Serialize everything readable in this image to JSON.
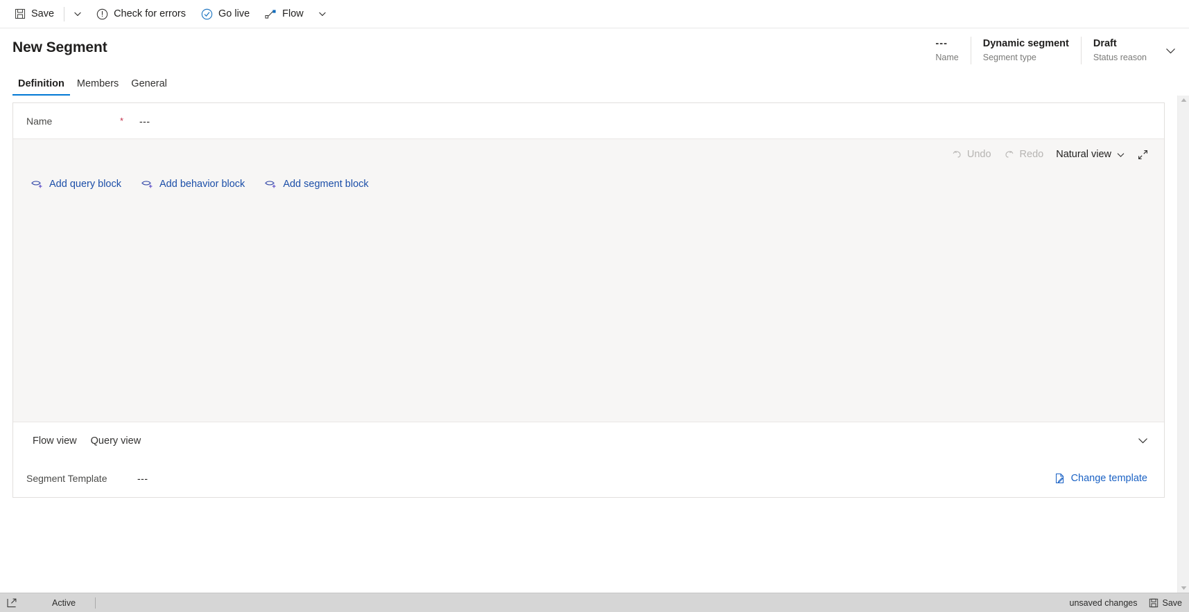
{
  "commandbar": {
    "save_label": "Save",
    "check_errors_label": "Check for errors",
    "go_live_label": "Go live",
    "flow_label": "Flow"
  },
  "header": {
    "title": "New Segment",
    "fields": [
      {
        "value": "---",
        "label": "Name"
      },
      {
        "value": "Dynamic segment",
        "label": "Segment type"
      },
      {
        "value": "Draft",
        "label": "Status reason"
      }
    ]
  },
  "tabs": [
    {
      "label": "Definition",
      "active": true
    },
    {
      "label": "Members",
      "active": false
    },
    {
      "label": "General",
      "active": false
    }
  ],
  "form": {
    "name_field": {
      "label": "Name",
      "required_marker": "*",
      "value": "---"
    }
  },
  "canvas": {
    "undo_label": "Undo",
    "redo_label": "Redo",
    "view_mode_label": "Natural view",
    "blocks": [
      {
        "label": "Add query block",
        "icon": "query-add-icon"
      },
      {
        "label": "Add behavior block",
        "icon": "query-add-icon"
      },
      {
        "label": "Add segment block",
        "icon": "query-add-icon"
      }
    ]
  },
  "flowbar": {
    "tabs": [
      {
        "label": "Flow view"
      },
      {
        "label": "Query view"
      }
    ]
  },
  "template": {
    "label": "Segment Template",
    "value": "---",
    "change_label": "Change template"
  },
  "statusbar": {
    "active_label": "Active",
    "unsaved_label": "unsaved changes",
    "save_label": "Save"
  },
  "colors": {
    "accent": "#0078d4",
    "link": "#1b62c4",
    "block_link": "#1b4ea8",
    "required": "#c4314b",
    "canvas_bg": "#f7f6f5",
    "statusbar_bg": "#d6d6d6"
  }
}
